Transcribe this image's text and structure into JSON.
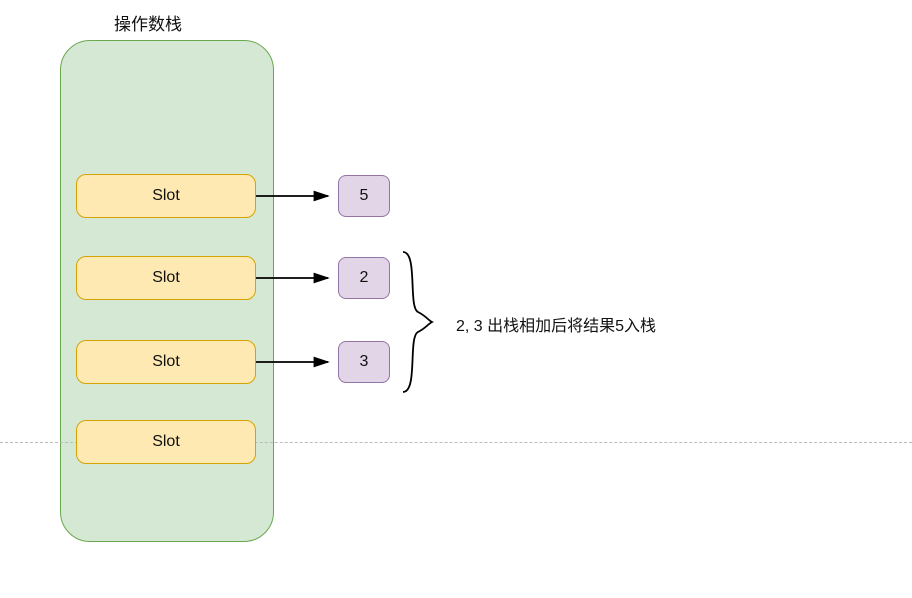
{
  "title": "操作数栈",
  "slots": [
    {
      "label": "Slot"
    },
    {
      "label": "Slot"
    },
    {
      "label": "Slot"
    },
    {
      "label": "Slot"
    }
  ],
  "values": {
    "v1": "5",
    "v2": "2",
    "v3": "3"
  },
  "annotation": "2, 3 出栈相加后将结果5入栈"
}
